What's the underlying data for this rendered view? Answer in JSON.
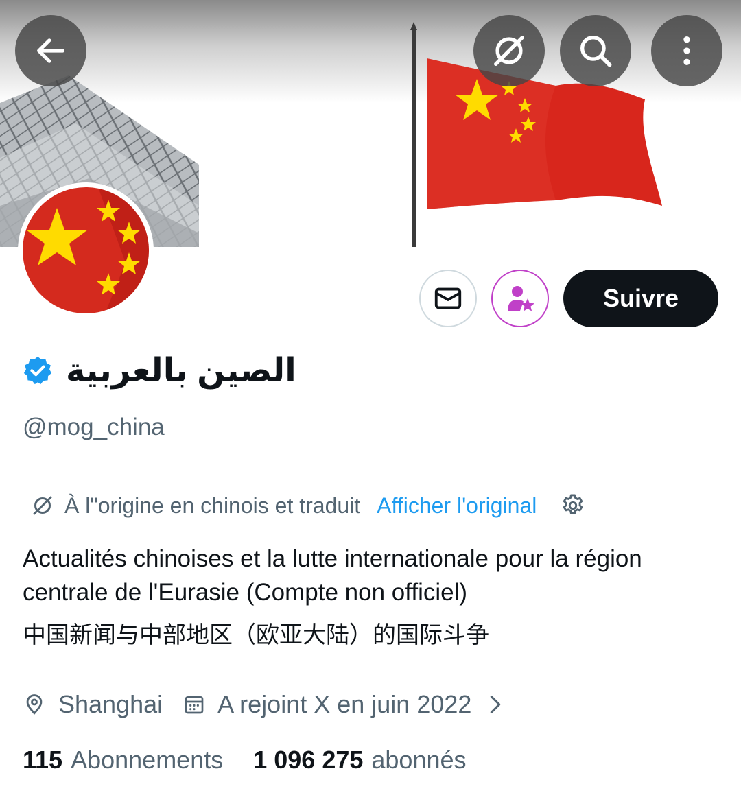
{
  "header": {
    "back_icon": "arrow-left-icon",
    "translate_icon": "translate-slash-icon",
    "search_icon": "search-icon",
    "more_icon": "more-vertical-icon"
  },
  "profile": {
    "display_name": "الصين بالعربية",
    "handle": "@mog_china",
    "verified": true,
    "verified_color": "#1d9bf0"
  },
  "actions": {
    "message_icon": "envelope-icon",
    "subscribe_icon": "user-star-icon",
    "subscribe_color": "#c040c8",
    "follow_label": "Suivre"
  },
  "translation": {
    "note": "À l\"origine en chinois et traduit",
    "show_original": "Afficher l'original",
    "link_color": "#1d9bf0"
  },
  "bio": {
    "translated": "Actualités chinoises et la lutte internationale pour la région centrale de l'Eurasie (Compte non officiel)",
    "original": "中国新闻与中部地区（欧亚大陆）的国际斗争"
  },
  "meta": {
    "location": "Shanghai",
    "joined": "A rejoint X en juin 2022"
  },
  "stats": {
    "following_count": "115",
    "following_label": "Abonnements",
    "followers_count": "1 096 275",
    "followers_label": "abonnés"
  }
}
